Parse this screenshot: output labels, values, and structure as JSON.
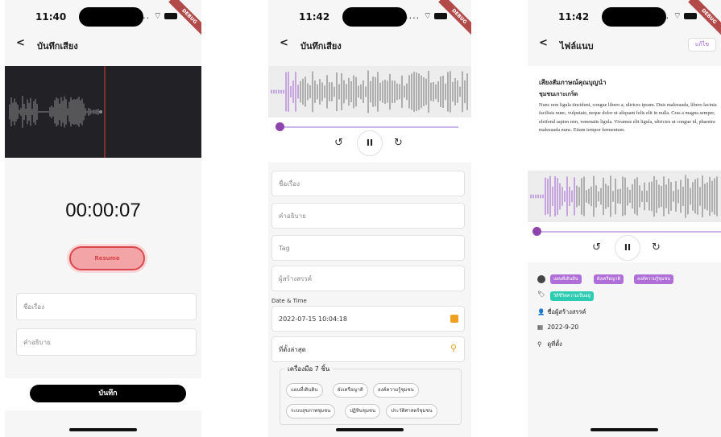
{
  "screens": [
    {
      "status": {
        "time": "11:40",
        "signal": "....",
        "badge": "DEBUG"
      },
      "nav": {
        "back": "<",
        "title": "บันทึกเสียง"
      },
      "timer": "00:00:07",
      "resume_label": "Resume",
      "fields": [
        {
          "placeholder": "ชื่อเรื่อง"
        },
        {
          "placeholder": "คำอธิบาย"
        }
      ],
      "save_label": "บันทึก"
    },
    {
      "status": {
        "time": "11:42",
        "signal": "....",
        "badge": "DEBUG"
      },
      "nav": {
        "back": "<",
        "title": "บันทึกเสียง"
      },
      "player": {
        "rewind": "↺",
        "pause": "II",
        "forward": "↻",
        "progress": 0.02
      },
      "fields": [
        {
          "placeholder": "ชื่อเรื่อง"
        },
        {
          "placeholder": "คำอธิบาย"
        },
        {
          "placeholder": "Tag"
        },
        {
          "placeholder": "ผู้สร้างสรรค์"
        }
      ],
      "date_label": "Date & Time",
      "date_value": "2022-07-15 10:04:18",
      "location_placeholder": "ที่ตั้งล่าสุด",
      "tools_title": "เครื่องมือ 7 ชิ้น",
      "tools_chips": [
        "แผนที่เดินดิน",
        "ผังเครือญาติ",
        "องค์ความรู้ชุมชน",
        "ระบบสุขภาพชุมชน",
        "ปฏิทินชุมชน",
        "ประวัติศาสตร์ชุมชน"
      ]
    },
    {
      "status": {
        "time": "11:42",
        "signal": "....",
        "badge": "DEBUG"
      },
      "nav": {
        "back": "<",
        "title": "ไฟล์แนบ",
        "edit": "แก้ไข"
      },
      "heading": "เสียงสัมภาษณ์คุณบุญนำ",
      "subheading": "ชุมชนเกาะเกร็ด",
      "body": "Nunc non ligula tincidunt, congue libero a, ultrices ipsum. Duis malesuada, libero lacinia facilisis nunc, vulputate, neque dolor ut aliquam felis elit in nulla. Cras a magna semper, eleifend sapien non, venenatis ligula. Vivamus elit ligula, ultricies ut congue id, pharetra malesuada nunc. Etiam tempor fermentum.",
      "player": {
        "rewind": "↺",
        "pause": "II",
        "forward": "↻",
        "progress": 0.02
      },
      "tool_tags": [
        "แผนที่เดินดิน",
        "ผังเครือญาติ",
        "องค์ความรู้ชุมชน"
      ],
      "topic_tags": [
        "วิถีชีวิตความเป็นอยู่"
      ],
      "creator": "ชื่อผู้สร้างสรรค์",
      "date": "2022-9-20",
      "location": "ดูที่ตั้ง"
    }
  ],
  "colors": {
    "accent": "#8e44ad",
    "resume": "#d8484c",
    "tag_purple": "#b06fd8",
    "tag_teal": "#2ecbb3",
    "waveform": "#707070",
    "recorder_bg": "#222226"
  }
}
